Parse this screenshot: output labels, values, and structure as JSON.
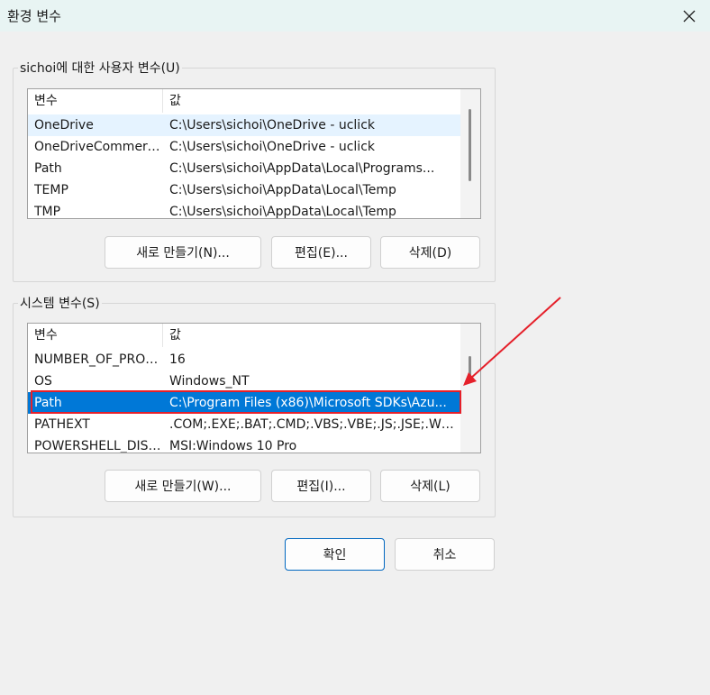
{
  "window": {
    "title": "환경 변수"
  },
  "user_vars": {
    "legend": "sichoi에 대한 사용자 변수(U)",
    "columns": [
      "변수",
      "값"
    ],
    "rows": [
      {
        "name": "OneDrive",
        "value": "C:\\Users\\sichoi\\OneDrive - uclick",
        "state": "hover"
      },
      {
        "name": "OneDriveCommerci...",
        "value": "C:\\Users\\sichoi\\OneDrive - uclick",
        "state": ""
      },
      {
        "name": "Path",
        "value": "C:\\Users\\sichoi\\AppData\\Local\\Programs...",
        "state": ""
      },
      {
        "name": "TEMP",
        "value": "C:\\Users\\sichoi\\AppData\\Local\\Temp",
        "state": ""
      },
      {
        "name": "TMP",
        "value": "C:\\Users\\sichoi\\AppData\\Local\\Temp",
        "state": ""
      }
    ],
    "buttons": {
      "new": "새로 만들기(N)...",
      "edit": "편집(E)...",
      "delete": "삭제(D)"
    }
  },
  "system_vars": {
    "legend": "시스템 변수(S)",
    "columns": [
      "변수",
      "값"
    ],
    "rows": [
      {
        "name": "NUMBER_OF_PROC...",
        "value": "16",
        "state": ""
      },
      {
        "name": "OS",
        "value": "Windows_NT",
        "state": ""
      },
      {
        "name": "Path",
        "value": "C:\\Program Files (x86)\\Microsoft SDKs\\Azu...",
        "state": "selected"
      },
      {
        "name": "PATHEXT",
        "value": ".COM;.EXE;.BAT;.CMD;.VBS;.VBE;.JS;.JSE;.WSF;...",
        "state": ""
      },
      {
        "name": "POWERSHELL_DIST...",
        "value": "MSI:Windows 10 Pro",
        "state": ""
      }
    ],
    "buttons": {
      "new": "새로 만들기(W)...",
      "edit": "편집(I)...",
      "delete": "삭제(L)"
    }
  },
  "footer": {
    "ok": "확인",
    "cancel": "취소"
  },
  "colors": {
    "selection": "#0078d7",
    "annotation": "#e5202a",
    "hover": "#e5f3ff"
  }
}
